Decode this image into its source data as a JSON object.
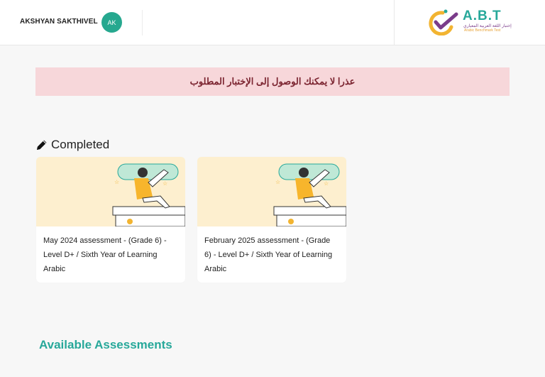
{
  "header": {
    "user_name": "AKSHYAN SAKTHIVEL",
    "avatar_initials": "AK",
    "logo": {
      "text": "A.B.T",
      "arabic_text": "إختبار اللغة العربية المعياري",
      "english_text": "Arabic Benchmark Test"
    }
  },
  "alert": {
    "message": "عذرا لا يمكنك الوصول إلى الإختبار المطلوب"
  },
  "completed": {
    "heading": "Completed",
    "icon": "pencil-icon",
    "cards": [
      {
        "title": "May 2024 assessment - (Grade 6) - Level D+ / Sixth Year of Learning Arabic",
        "image_icon": "student-telescope-illustration"
      },
      {
        "title": "February 2025 assessment - (Grade 6) - Level D+ / Sixth Year of Learning Arabic",
        "image_icon": "student-telescope-illustration"
      }
    ]
  },
  "available": {
    "heading": "Available Assessments"
  },
  "colors": {
    "accent": "#27a89a",
    "alert_bg": "#f7d7da",
    "alert_text": "#7b2430",
    "card_image_bg": "#fdefcf"
  }
}
